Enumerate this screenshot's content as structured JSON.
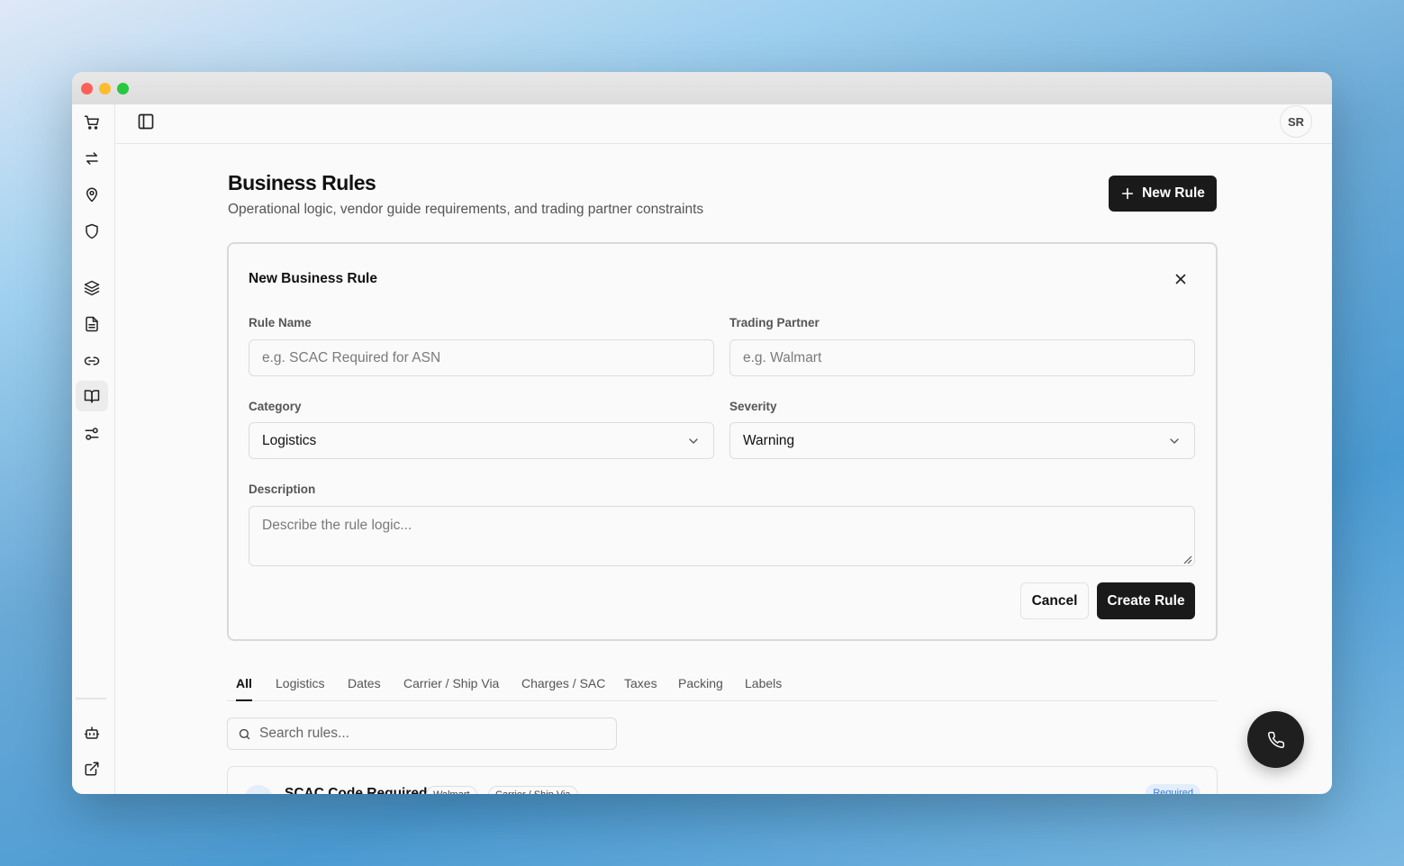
{
  "window": {
    "controls": [
      "close",
      "minimize",
      "maximize"
    ]
  },
  "sidebar": {
    "items": [
      {
        "icon": "cart-icon",
        "name": "sidebar-item-orders"
      },
      {
        "icon": "arrows-swap-icon",
        "name": "sidebar-item-transactions"
      },
      {
        "icon": "map-pin-icon",
        "name": "sidebar-item-locations"
      },
      {
        "icon": "shield-icon",
        "name": "sidebar-item-security"
      },
      {
        "icon": "layers-icon",
        "name": "sidebar-item-layers"
      },
      {
        "icon": "document-icon",
        "name": "sidebar-item-documents"
      },
      {
        "icon": "link-icon",
        "name": "sidebar-item-connections"
      },
      {
        "icon": "book-open-icon",
        "name": "sidebar-item-business-rules",
        "active": true
      },
      {
        "icon": "sliders-icon",
        "name": "sidebar-item-settings"
      }
    ],
    "bottom_items": [
      {
        "icon": "bot-icon",
        "name": "sidebar-item-assistant"
      },
      {
        "icon": "external-link-icon",
        "name": "sidebar-item-external"
      }
    ]
  },
  "topbar": {
    "avatar_initials": "SR"
  },
  "page": {
    "title": "Business Rules",
    "subtitle": "Operational logic, vendor guide requirements, and trading partner constraints",
    "new_rule_label": "New Rule"
  },
  "form": {
    "title": "New Business Rule",
    "rule_name": {
      "label": "Rule Name",
      "value": "",
      "placeholder": "e.g. SCAC Required for ASN"
    },
    "trading_partner": {
      "label": "Trading Partner",
      "value": "",
      "placeholder": "e.g. Walmart"
    },
    "category": {
      "label": "Category",
      "value": "Logistics"
    },
    "severity": {
      "label": "Severity",
      "value": "Warning"
    },
    "description": {
      "label": "Description",
      "value": "",
      "placeholder": "Describe the rule logic..."
    },
    "cancel_label": "Cancel",
    "create_label": "Create Rule"
  },
  "tabs": [
    {
      "label": "All",
      "active": true
    },
    {
      "label": "Logistics"
    },
    {
      "label": "Dates"
    },
    {
      "label": "Carrier / Ship Via"
    },
    {
      "label": "Charges / SAC"
    },
    {
      "label": "Taxes"
    },
    {
      "label": "Packing"
    },
    {
      "label": "Labels"
    }
  ],
  "search": {
    "placeholder": "Search rules...",
    "value": ""
  },
  "rules": [
    {
      "name": "SCAC Code Required",
      "partner": "Walmart",
      "category": "Carrier / Ship Via",
      "badge": "Required"
    }
  ],
  "colors": {
    "primary": "#1a1a1a",
    "badge_blue": "#3b7dd8",
    "badge_bg": "#e2eefb"
  }
}
